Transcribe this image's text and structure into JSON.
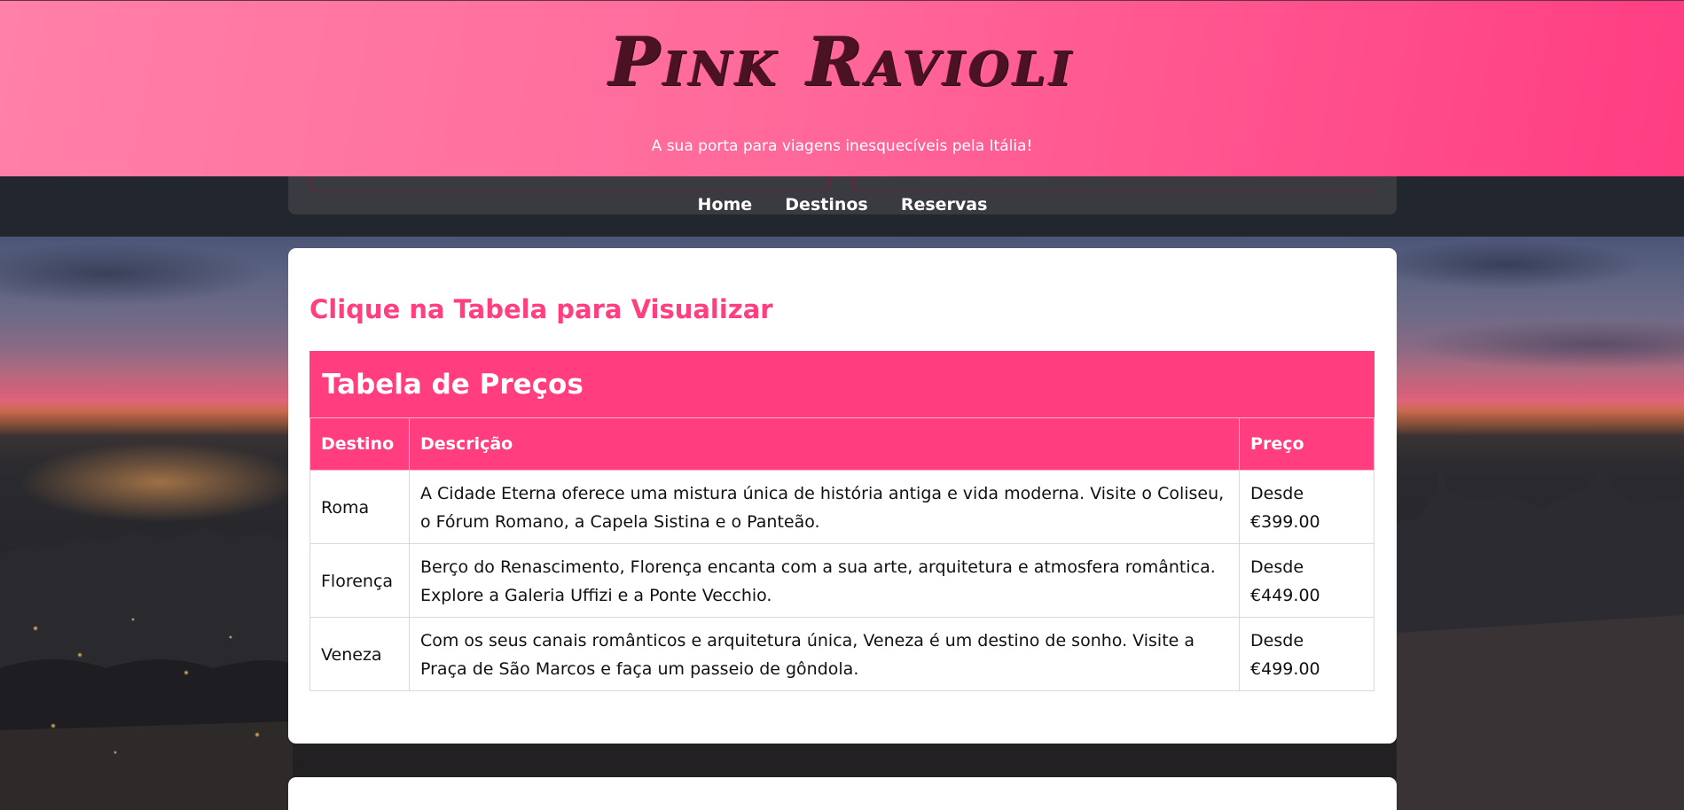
{
  "header": {
    "brand": "Pink Ravioli",
    "tagline": "A sua porta para viagens inesquecíveis pela Itália!"
  },
  "nav": {
    "items": [
      {
        "label": "Home"
      },
      {
        "label": "Destinos"
      },
      {
        "label": "Reservas"
      }
    ]
  },
  "main": {
    "heading": "Clique na Tabela para Visualizar",
    "table": {
      "caption": "Tabela de Preços",
      "columns": [
        "Destino",
        "Descrição",
        "Preço"
      ],
      "rows": [
        {
          "destino": "Roma",
          "descricao": "A Cidade Eterna oferece uma mistura única de história antiga e vida moderna. Visite o Coliseu, o Fórum Romano, a Capela Sistina e o Panteão.",
          "preco_prefix": "Desde",
          "preco_value": "€399.00"
        },
        {
          "destino": "Florença",
          "descricao": "Berço do Renascimento, Florença encanta com a sua arte, arquitetura e atmosfera romântica. Explore a Galeria Uffizi e a Ponte Vecchio.",
          "preco_prefix": "Desde",
          "preco_value": "€449.00"
        },
        {
          "destino": "Veneza",
          "descricao": "Com os seus canais românticos e arquitetura única, Veneza é um destino de sonho. Visite a Praça de São Marcos e faça um passeio de gôndola.",
          "preco_prefix": "Desde",
          "preco_value": "€499.00"
        }
      ]
    }
  },
  "colors": {
    "header_gradient_start": "#ff80a8",
    "header_gradient_end": "#ff3d82",
    "accent_pink": "#ff3d7f",
    "logo_text": "#4a1222",
    "nav_background": "#22262f"
  }
}
